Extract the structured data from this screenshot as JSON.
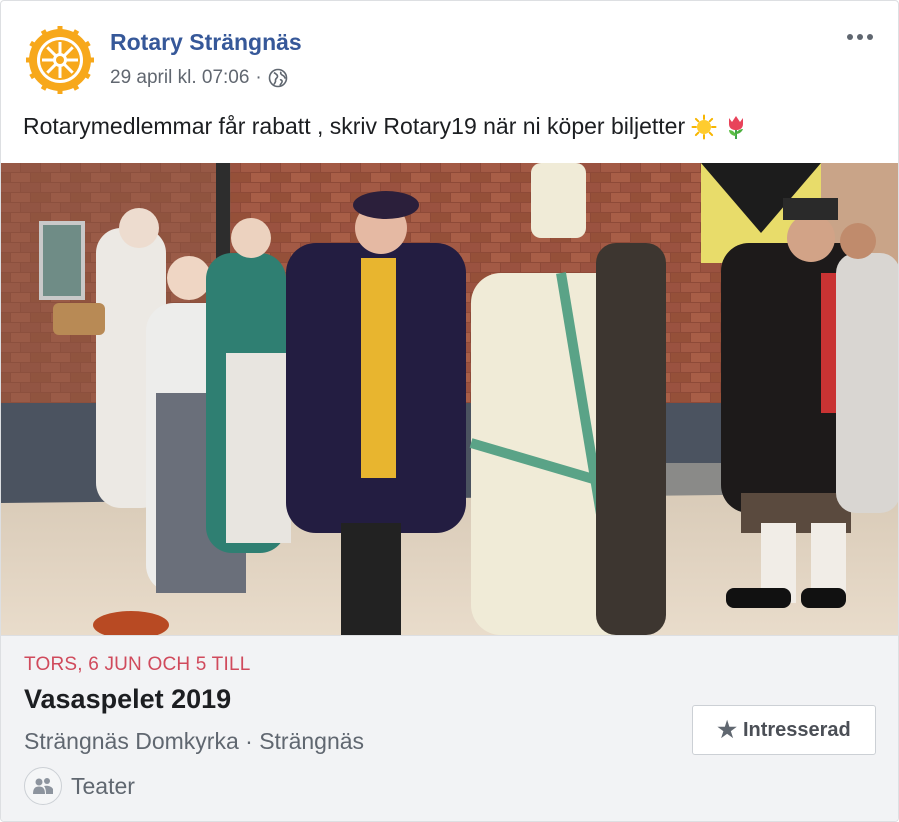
{
  "post": {
    "author": "Rotary Strängnäs",
    "timestamp": "29 april kl. 07:06",
    "separator": "·",
    "privacy_icon": "globe-icon",
    "more_icon": "more-options-icon",
    "text": "Rotarymedlemmar får rabatt , skriv Rotary19 när ni köper biljetter",
    "emojis": [
      "sun-emoji",
      "tulip-emoji"
    ],
    "avatar_logo": "rotary-wheel-logo"
  },
  "event": {
    "date": "TORS, 6 JUN OCH 5 TILL",
    "title": "Vasaspelet 2019",
    "location": "Strängnäs Domkyrka · Strängnäs",
    "category": "Teater",
    "category_icon": "people-icon",
    "interested_label": "Intresserad",
    "interested_icon": "star-icon"
  },
  "colors": {
    "author_link": "#365899",
    "event_date": "#d04a5c",
    "rotary_gold": "#f7a81b",
    "footer_bg": "#f2f3f5"
  }
}
